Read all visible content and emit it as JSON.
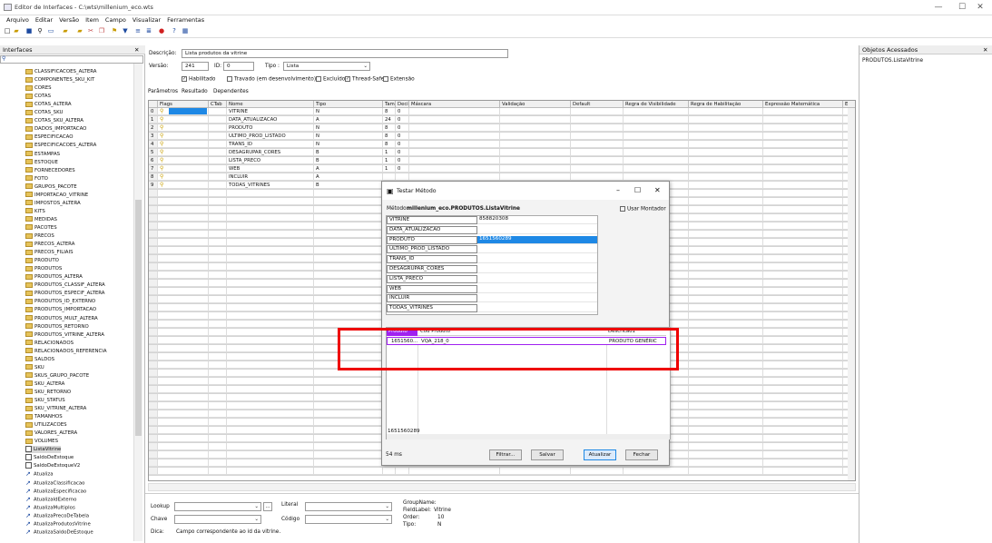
{
  "window": {
    "title": "Editor de Interfaces - C:\\wts\\millenium_eco.wts",
    "minimize": "—",
    "maximize": "☐",
    "close": "✕"
  },
  "menu": [
    "Arquivo",
    "Editar",
    "Versão",
    "Item",
    "Campo",
    "Visualizar",
    "Ferramentas"
  ],
  "left_panel": {
    "title": "Interfaces",
    "close": "✕",
    "items": [
      {
        "label": "CLASSIFICACOES_ALTERA",
        "type": "folder"
      },
      {
        "label": "COMPONENTES_SKU_KIT",
        "type": "folder"
      },
      {
        "label": "CORES",
        "type": "folder"
      },
      {
        "label": "COTAS",
        "type": "folder"
      },
      {
        "label": "COTAS_ALTERA",
        "type": "folder"
      },
      {
        "label": "COTAS_SKU",
        "type": "folder"
      },
      {
        "label": "COTAS_SKU_ALTERA",
        "type": "folder"
      },
      {
        "label": "DADOS_IMPORTACAO",
        "type": "folder"
      },
      {
        "label": "ESPECIFICACAO",
        "type": "folder"
      },
      {
        "label": "ESPECIFICACOES_ALTERA",
        "type": "folder"
      },
      {
        "label": "ESTAMPAS",
        "type": "folder"
      },
      {
        "label": "ESTOQUE",
        "type": "folder"
      },
      {
        "label": "FORNECEDORES",
        "type": "folder"
      },
      {
        "label": "FOTO",
        "type": "folder"
      },
      {
        "label": "GRUPOS_PACOTE",
        "type": "folder"
      },
      {
        "label": "IMPORTACAO_VITRINE",
        "type": "folder"
      },
      {
        "label": "IMPOSTOS_ALTERA",
        "type": "folder"
      },
      {
        "label": "KITS",
        "type": "folder"
      },
      {
        "label": "MEDIDAS",
        "type": "folder"
      },
      {
        "label": "PACOTES",
        "type": "folder"
      },
      {
        "label": "PRECOS",
        "type": "folder"
      },
      {
        "label": "PRECOS_ALTERA",
        "type": "folder"
      },
      {
        "label": "PRECOS_FILIAIS",
        "type": "folder"
      },
      {
        "label": "PRODUTO",
        "type": "folder"
      },
      {
        "label": "PRODUTOS",
        "type": "folder"
      },
      {
        "label": "PRODUTOS_ALTERA",
        "type": "folder"
      },
      {
        "label": "PRODUTOS_CLASSIF_ALTERA",
        "type": "folder"
      },
      {
        "label": "PRODUTOS_ESPECIF_ALTERA",
        "type": "folder"
      },
      {
        "label": "PRODUTOS_ID_EXTERNO",
        "type": "folder"
      },
      {
        "label": "PRODUTOS_IMPORTACAO",
        "type": "folder"
      },
      {
        "label": "PRODUTOS_MULT_ALTERA",
        "type": "folder"
      },
      {
        "label": "PRODUTOS_RETORNO",
        "type": "folder"
      },
      {
        "label": "PRODUTOS_VITRINE_ALTERA",
        "type": "folder"
      },
      {
        "label": "RELACIONADOS",
        "type": "folder"
      },
      {
        "label": "RELACIONADOS_REFERENCIA",
        "type": "folder"
      },
      {
        "label": "SALDOS",
        "type": "folder"
      },
      {
        "label": "SKU",
        "type": "folder"
      },
      {
        "label": "SKUS_GRUPO_PACOTE",
        "type": "folder"
      },
      {
        "label": "SKU_ALTERA",
        "type": "folder"
      },
      {
        "label": "SKU_RETORNO",
        "type": "folder"
      },
      {
        "label": "SKU_STATUS",
        "type": "folder"
      },
      {
        "label": "SKU_VITRINE_ALTERA",
        "type": "folder"
      },
      {
        "label": "TAMANHOS",
        "type": "folder"
      },
      {
        "label": "UTILIZACOES",
        "type": "folder"
      },
      {
        "label": "VALORES_ALTERA",
        "type": "folder"
      },
      {
        "label": "VOLUMES",
        "type": "folder"
      },
      {
        "label": "ListaVitrine",
        "type": "doc",
        "selected": true
      },
      {
        "label": "SaldoDeEstoque",
        "type": "doc"
      },
      {
        "label": "SaldoDeEstoqueV2",
        "type": "doc"
      },
      {
        "label": "Atualiza",
        "type": "method"
      },
      {
        "label": "AtualizaClassificacao",
        "type": "method"
      },
      {
        "label": "AtualizaEspecificacao",
        "type": "method"
      },
      {
        "label": "AtualizaIdExterno",
        "type": "method"
      },
      {
        "label": "AtualizaMultiplos",
        "type": "method"
      },
      {
        "label": "AtualizaPrecoDeTabela",
        "type": "method"
      },
      {
        "label": "AtualizaProdutosVitrine",
        "type": "method"
      },
      {
        "label": "AtualizaSaldoDeEstoque",
        "type": "method"
      }
    ]
  },
  "form": {
    "descricao_label": "Descrição:",
    "descricao_value": "Lista produtos da vitrine",
    "versao_label": "Versão:",
    "versao_value": "241",
    "id_label": "ID:",
    "id_value": "0",
    "tipo_label": "Tipo :",
    "tipo_value": "Lista",
    "habilitado": "Habilitado",
    "travado": "Travado (em desenvolvimento)",
    "excluido": "Excluído",
    "thread_safe": "Thread-Safe",
    "extensao": "Extensão"
  },
  "tabs": [
    "Parâmetros",
    "Resultado",
    "Dependentes"
  ],
  "grid": {
    "headers": [
      "Flags",
      "CTab",
      "Nome",
      "Tipo",
      "Tamanho",
      "Decimais",
      "Máscara",
      "Validação",
      "Default",
      "Regra de Visibilidade",
      "Regra de Habilitação",
      "Expressão Matemática",
      "E"
    ],
    "rows": [
      {
        "idx": "0",
        "nome": "VITRINE",
        "tipo": "N",
        "tam": "8",
        "dec": "0"
      },
      {
        "idx": "1",
        "nome": "DATA_ATUALIZACAO",
        "tipo": "A",
        "tam": "24",
        "dec": "0"
      },
      {
        "idx": "2",
        "nome": "PRODUTO",
        "tipo": "N",
        "tam": "8",
        "dec": "0"
      },
      {
        "idx": "3",
        "nome": "ULTIMO_PROD_LISTADO",
        "tipo": "N",
        "tam": "8",
        "dec": "0"
      },
      {
        "idx": "4",
        "nome": "TRANS_ID",
        "tipo": "N",
        "tam": "8",
        "dec": "0"
      },
      {
        "idx": "5",
        "nome": "DESAGRUPAR_CORES",
        "tipo": "B",
        "tam": "1",
        "dec": "0"
      },
      {
        "idx": "6",
        "nome": "LISTA_PRECO",
        "tipo": "B",
        "tam": "1",
        "dec": "0"
      },
      {
        "idx": "7",
        "nome": "WEB",
        "tipo": "A",
        "tam": "1",
        "dec": "0"
      },
      {
        "idx": "8",
        "nome": "INCLUIR",
        "tipo": "A",
        "tam": "",
        "dec": ""
      },
      {
        "idx": "9",
        "nome": "TODAS_VITRINES",
        "tipo": "B",
        "tam": "",
        "dec": ""
      }
    ]
  },
  "bottom": {
    "lookup": "Lookup",
    "chave": "Chave",
    "dica": "Dica:",
    "dica_value": "Campo correspondente ao id da vitrine.",
    "literal": "Literal",
    "codigo": "Código",
    "ellipsis": "...",
    "group_name": "GroupName:",
    "field_label": "FieldLabel:",
    "field_label_value": "Vitrine",
    "order": "Order:",
    "order_value": "10",
    "tipo": "Tipo:",
    "tipo_value": "N"
  },
  "right_panel": {
    "title": "Objetos Acessados",
    "close": "✕",
    "item": "PRODUTOS.ListaVitrine"
  },
  "dialog": {
    "title": "Testar Método",
    "metodo_label": "Método:",
    "metodo_value": "millenium_eco.PRODUTOS.ListaVitrine",
    "usar_montador": "Usar Montador",
    "params": [
      {
        "name": "VITRINE",
        "value": "858820308"
      },
      {
        "name": "DATA_ATUALIZACAO",
        "value": ""
      },
      {
        "name": "PRODUTO",
        "value": "1651560289"
      },
      {
        "name": "ULTIMO_PROD_LISTADO",
        "value": ""
      },
      {
        "name": "TRANS_ID",
        "value": ""
      },
      {
        "name": "DESAGRUPAR_CORES",
        "value": ""
      },
      {
        "name": "LISTA_PRECO",
        "value": ""
      },
      {
        "name": "WEB",
        "value": ""
      },
      {
        "name": "INCLUIR",
        "value": ""
      },
      {
        "name": "TODAS_VITRINES",
        "value": ""
      }
    ],
    "result_headers": [
      "Produto",
      "Cod Produto",
      "Descricao1"
    ],
    "result_row": [
      "1651560...",
      "VQA_218_0",
      "PRODUTO GENÉRIC"
    ],
    "footer_value": "1651560289",
    "elapsed": "54 ms",
    "buttons": {
      "filtrar": "Filtrar...",
      "salvar": "Salvar",
      "atualizar": "Atualizar",
      "fechar": "Fechar"
    }
  },
  "colors": {
    "highlight": "#e00000",
    "selection_blue": "#1e88e5",
    "result_header_purple": "#a020f0"
  }
}
